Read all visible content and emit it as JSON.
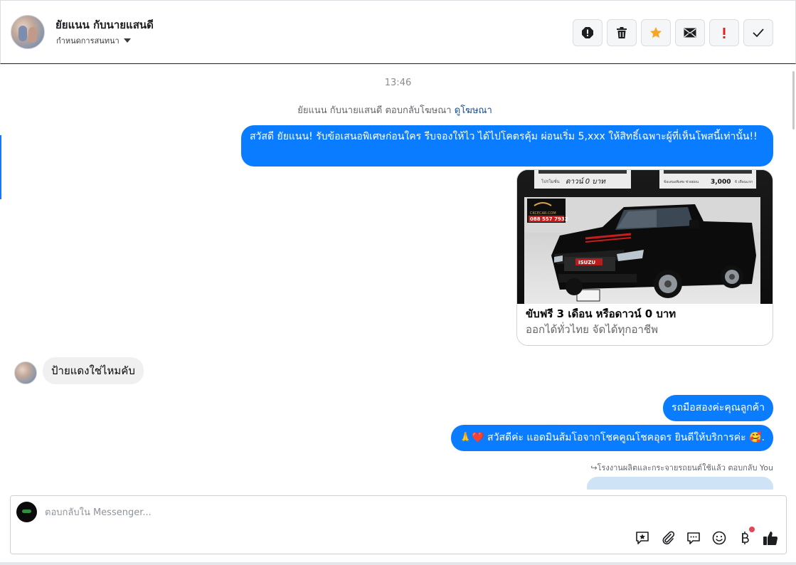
{
  "header": {
    "contact_name": "ยัยแนน กับนายแสนดี",
    "subtitle": "กำหนดการสนทนา",
    "toolbar": [
      "report-icon",
      "trash-icon",
      "star-icon",
      "envelope-icon",
      "exclamation-icon",
      "check-icon"
    ]
  },
  "thread": {
    "timestamp": "13:46",
    "ad_reply_text": "ยัยแนน กับนายแสนดี ตอบกลับโฆษณา",
    "ad_reply_link": "ดูโฆษณา",
    "outgoing_1": "สวัสดี ยัยแนน! รับข้อเสนอพิเศษก่อนใคร รีบจองให้ไว ได้ไปโคตรคุ้ม ผ่อนเริ่ม 5,xxx  ให้สิทธิ์เฉพาะผู้ที่เห็นโพสนี้เท่านั้น!!",
    "card": {
      "title": "ขับฟรี 3 เดือน หรือดาวน์ 0 บาท",
      "description": "ออกได้ทั่วไทย จัดได้ทุกอาชีพ",
      "image_labels": {
        "top_left_caption": "ดาวน์ 0 บาท",
        "top_left_prefix": "โปรโมชั่น",
        "top_right_prefix": "ข้อเสนอพิเศษ ช่วยผ่อน",
        "top_right_amount": "3,000",
        "top_right_suffix": "6 เดือนแรก",
        "site": "CKCECAR.COM",
        "phone": "088 557 7932",
        "plate": "ISUZU"
      }
    },
    "incoming_1": "ป้ายแดงใช่ไหมคับ",
    "outgoing_2": "รถมือสองค่ะคุณลูกค้า",
    "outgoing_3_prefix": "🙏❤️",
    "outgoing_3": "สวัสดีค่ะ แอดมินส้มโอจากโชคคูณโชคอุดร ยินดีให้บริการค่ะ",
    "outgoing_3_suffix": "🥰.",
    "reply_note": "↪โรงงานผลิตและกระจายรถยนต์ใช้แล้ว ตอบกลับ You"
  },
  "composer": {
    "placeholder": "ตอบกลับใน Messenger...",
    "tools": [
      "saved-reply-icon",
      "attachment-icon",
      "chat-bubble-icon",
      "emoji-icon",
      "baht-icon",
      "thumbs-up-icon"
    ]
  },
  "colors": {
    "outgoing_bubble": "#0a7cff",
    "incoming_bubble": "#f0f0f0",
    "star": "#f5a623",
    "alert_red": "#e02020",
    "link": "#1b4e8f"
  }
}
